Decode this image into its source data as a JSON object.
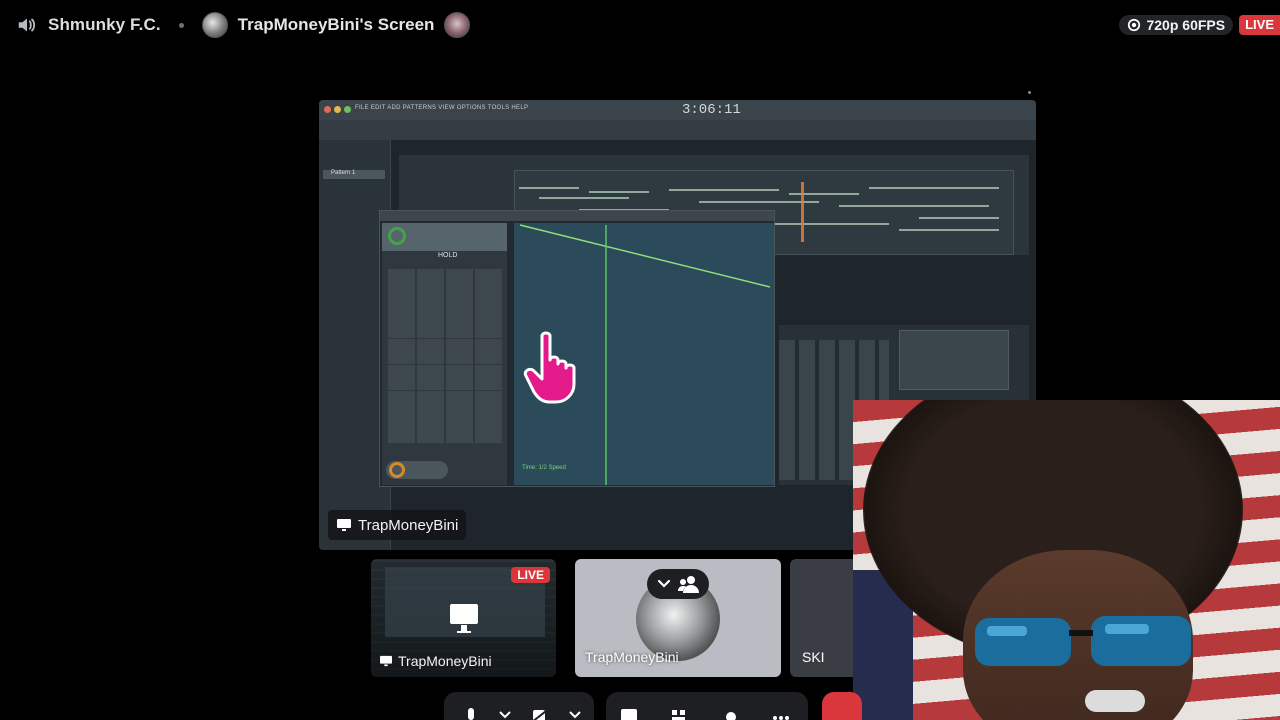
{
  "header": {
    "server_name": "Shmunky F.C.",
    "screen_title": "TrapMoneyBini's Screen",
    "quality": "720p 60FPS",
    "live_label": "LIVE"
  },
  "stream": {
    "name_tag": "TrapMoneyBini",
    "fl_time": "3:06:11",
    "fl_menu": "FILE EDIT ADD PATTERNS VIEW OPTIONS TOOLS HELP",
    "fl_pattern": "Pattern 1",
    "gb_hold": "HOLD",
    "gb_status": "Time: 1/2 Speed"
  },
  "participants": [
    {
      "name": "TrapMoneyBini",
      "badge": "LIVE",
      "type": "screen"
    },
    {
      "name": "TrapMoneyBini",
      "type": "avatar"
    },
    {
      "name": "SKI",
      "type": "user"
    }
  ],
  "colors": {
    "live_red": "#da373c",
    "panel_dark": "#1e1f22",
    "hand_pink": "#e4198a"
  }
}
